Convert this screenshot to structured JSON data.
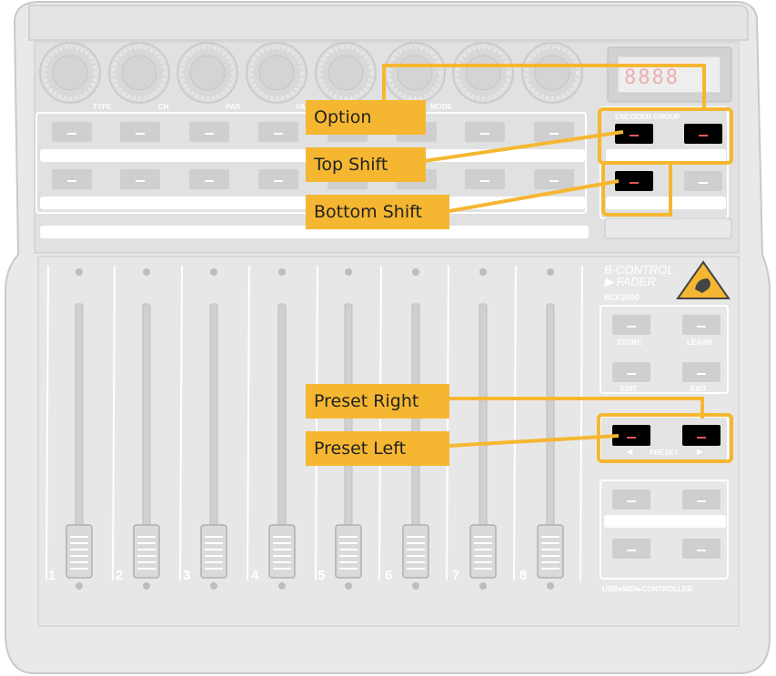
{
  "device": {
    "brand_line1": "B-CONTROL",
    "brand_line2": "▶ FADER",
    "model": "BCF2000",
    "footer": "USB●MIDI●CONTROLLER",
    "display_digits": "8888",
    "encoder_group_label": "ENCODER GROUP",
    "knob_labels": [
      "TYPE",
      "CH",
      "PAR",
      "VA",
      "MODE"
    ],
    "store_label": "STORE",
    "learn_label": "LEARN",
    "edit_label": "EDIT",
    "exit_label": "EXIT",
    "preset_label": "PRESET",
    "preset_left_arrow": "◀",
    "preset_right_arrow": "▶",
    "channel_numbers": [
      "1",
      "2",
      "3",
      "4",
      "5",
      "6",
      "7",
      "8"
    ]
  },
  "callouts": {
    "option": "Option",
    "top_shift": "Top Shift",
    "bottom_shift": "Bottom Shift",
    "preset_right": "Preset Right",
    "preset_left": "Preset Left"
  },
  "colors": {
    "highlight": "#f5b731",
    "device_body": "#e7e7e7",
    "device_outline": "#c8c8c8",
    "active_button": "#000000",
    "led_red": "#e35a5a"
  }
}
